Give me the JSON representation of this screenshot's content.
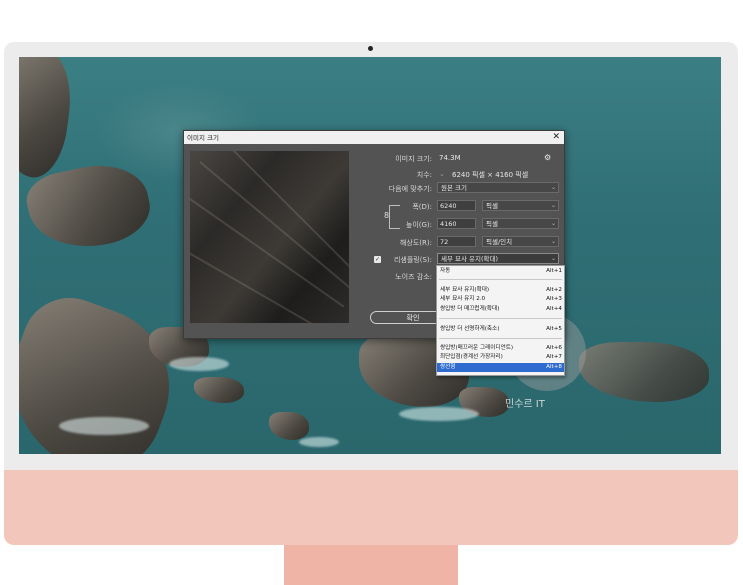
{
  "dialog": {
    "title": "이미지 크기",
    "close": "✕",
    "image_size_label": "이미지 크기:",
    "image_size_value": "74.3M",
    "dimensions_label": "치수:",
    "dimensions_value": "6240 픽셀 × 4160 픽셀",
    "fit_to_label": "다음에 맞추기:",
    "fit_to_value": "원본 크기",
    "width_label": "폭(D):",
    "width_value": "6240",
    "width_unit": "픽셀",
    "height_label": "높이(G):",
    "height_value": "4160",
    "height_unit": "픽셀",
    "resolution_label": "해상도(R):",
    "resolution_value": "72",
    "resolution_unit": "픽셀/인치",
    "resample_label": "리샘플링(S):",
    "resample_value": "세부 묘사 유지(확대)",
    "noise_label": "노이즈 감소:",
    "ok_button": "확인"
  },
  "resample_menu": {
    "items": [
      {
        "label": "자동",
        "shortcut": "Alt+1"
      },
      {
        "label": "세부 묘사 유지(확대)",
        "shortcut": "Alt+2"
      },
      {
        "label": "세부 묘사 유지 2.0",
        "shortcut": "Alt+3"
      },
      {
        "label": "쌍입방 더 매끄럽게(확대)",
        "shortcut": "Alt+4"
      },
      {
        "label": "쌍입방 더 선명하게(축소)",
        "shortcut": "Alt+5"
      },
      {
        "label": "쌍입방(매끄러운 그레이디언트)",
        "shortcut": "Alt+6"
      },
      {
        "label": "최단입점(경계선 가장자리)",
        "shortcut": "Alt+7"
      },
      {
        "label": "쌍선형",
        "shortcut": "Alt+8"
      }
    ],
    "selected_index": 7
  },
  "watermark": "민수르 IT",
  "colors": {
    "dialog_bg": "#535353",
    "selected_item": "#2f6bcf",
    "imac_chin": "#f3c6bb"
  }
}
